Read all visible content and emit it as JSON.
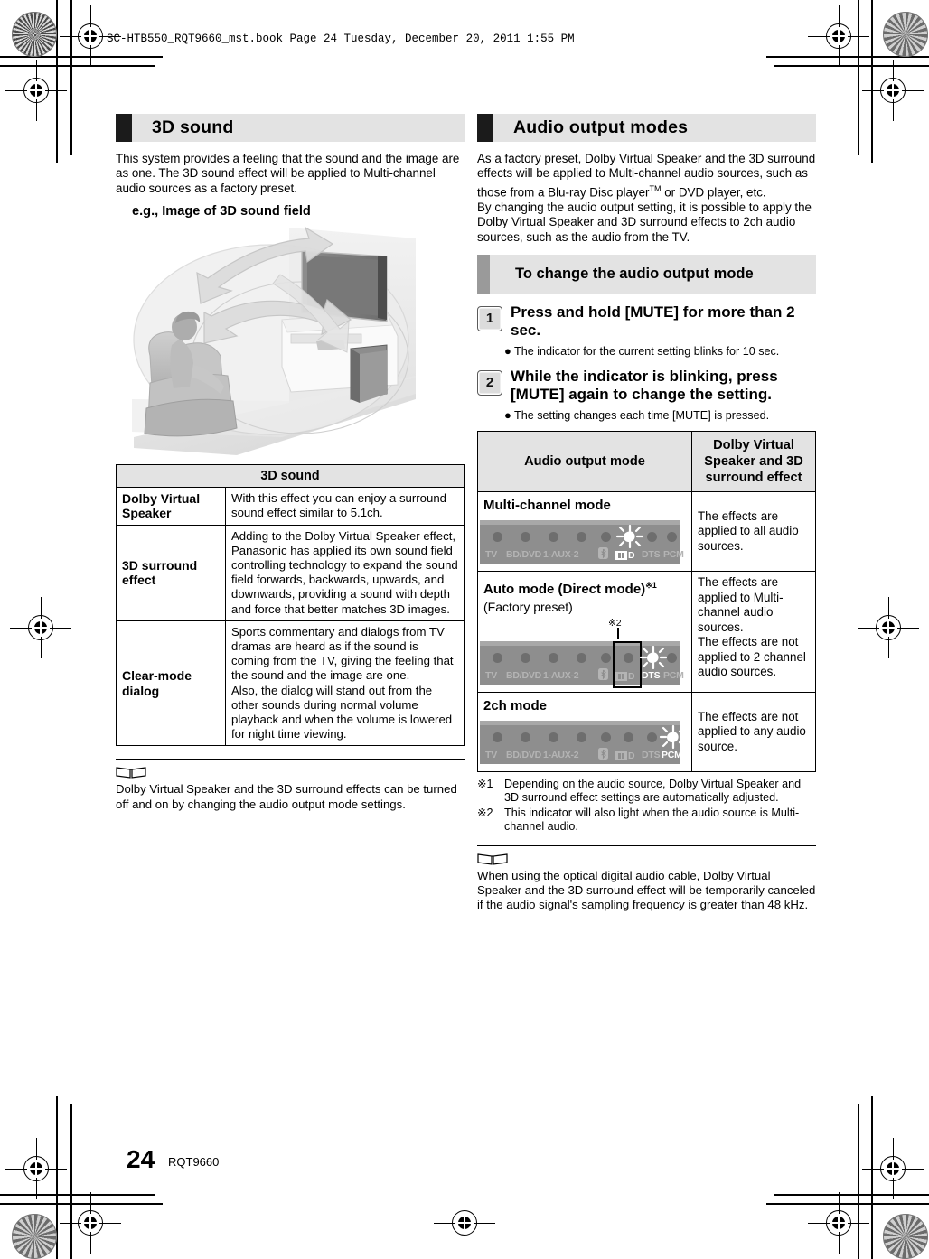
{
  "print": {
    "slug": "SC-HTB550_RQT9660_mst.book  Page 24  Tuesday, December 20, 2011  1:55 PM"
  },
  "footer": {
    "page_number": "24",
    "doc_code": "RQT9660"
  },
  "left_column": {
    "section_title": "3D sound",
    "intro": "This system provides a feeling that the sound and the image are as one. The 3D sound effect will be applied to Multi-channel audio sources as a factory preset.",
    "figure_caption": "e.g., Image of 3D sound field",
    "table": {
      "header": "3D sound",
      "rows": [
        {
          "name": "Dolby Virtual Speaker",
          "desc": "With this effect you can enjoy a surround sound effect similar to 5.1ch."
        },
        {
          "name": "3D surround effect",
          "desc": "Adding to the Dolby Virtual Speaker effect, Panasonic has applied its own sound field controlling technology to expand the sound field forwards, backwards, upwards, and downwards, providing a sound with depth and force that better matches 3D images."
        },
        {
          "name": "Clear-mode dialog",
          "desc": "Sports commentary and dialogs from TV dramas are heard as if the sound is coming from the TV, giving the feeling that the sound and the image are one.\nAlso, the dialog will stand out from the other sounds during normal volume playback and when the volume is lowered for night time viewing."
        }
      ]
    },
    "note": "Dolby Virtual Speaker and the 3D surround effects can be turned off and on by changing the audio output mode settings."
  },
  "right_column": {
    "section_title": "Audio output modes",
    "intro_1": "As a factory preset, Dolby Virtual Speaker and the 3D surround effects will be applied to Multi-channel audio sources, such as those from a Blu-ray Disc player",
    "intro_1_sup": "TM",
    "intro_1_tail": " or DVD player, etc.",
    "intro_2": "By changing the audio output setting, it is possible to apply the Dolby Virtual Speaker and 3D surround effects to 2ch audio sources, such as the audio from the TV.",
    "subsection_title": "To change the audio output mode",
    "steps": [
      {
        "num": "1",
        "text": "Press and hold [MUTE] for more than 2 sec.",
        "bullet": "The indicator for the current setting blinks for 10 sec."
      },
      {
        "num": "2",
        "text": "While the indicator is blinking, press [MUTE] again to change the setting.",
        "bullet": "The setting changes each time [MUTE] is pressed."
      }
    ],
    "table": {
      "header_mode": "Audio output mode",
      "header_effect": "Dolby Virtual Speaker and 3D surround effect",
      "rows": [
        {
          "mode_name": "Multi-channel mode",
          "mode_sub": "",
          "mode_sup": "",
          "effect": "The effects are applied to all audio sources.",
          "panel": {
            "lit": "DD",
            "callout": "",
            "boxed": ""
          }
        },
        {
          "mode_name": "Auto mode (Direct mode)",
          "mode_sup": "※1",
          "mode_sub": "(Factory preset)",
          "effect": "The effects are applied to Multi-channel audio sources.\nThe effects are not applied to 2 channel audio sources.",
          "panel": {
            "lit": "DTS",
            "callout": "※2",
            "boxed": "DD"
          }
        },
        {
          "mode_name": "2ch mode",
          "mode_sub": "",
          "mode_sup": "",
          "effect": "The effects are not applied to any audio source.",
          "panel": {
            "lit": "PCM",
            "callout": "",
            "boxed": ""
          }
        }
      ]
    },
    "panel_labels": [
      "TV",
      "BD/DVD",
      "1-AUX-2",
      "ⓑ",
      "DD",
      "DTS",
      "PCM"
    ],
    "footnotes": [
      {
        "mark": "※1",
        "text": "Depending on the audio source, Dolby Virtual Speaker and 3D surround effect settings are automatically adjusted."
      },
      {
        "mark": "※2",
        "text": "This indicator will also light when the audio source is Multi-channel audio."
      }
    ],
    "note": "When using the optical digital audio cable, Dolby Virtual Speaker and the 3D surround effect will be temporarily canceled if the audio signal's sampling frequency is greater than 48 kHz."
  },
  "colors": {
    "section_bar_bg": "#e3e3e3",
    "section_tab": "#1b1b1b",
    "sub_tab": "#9a9a9a",
    "panel_bg": "#8e8e8e",
    "panel_dim_text": "#b4b4b4",
    "panel_lit_text": "#ffffff"
  }
}
